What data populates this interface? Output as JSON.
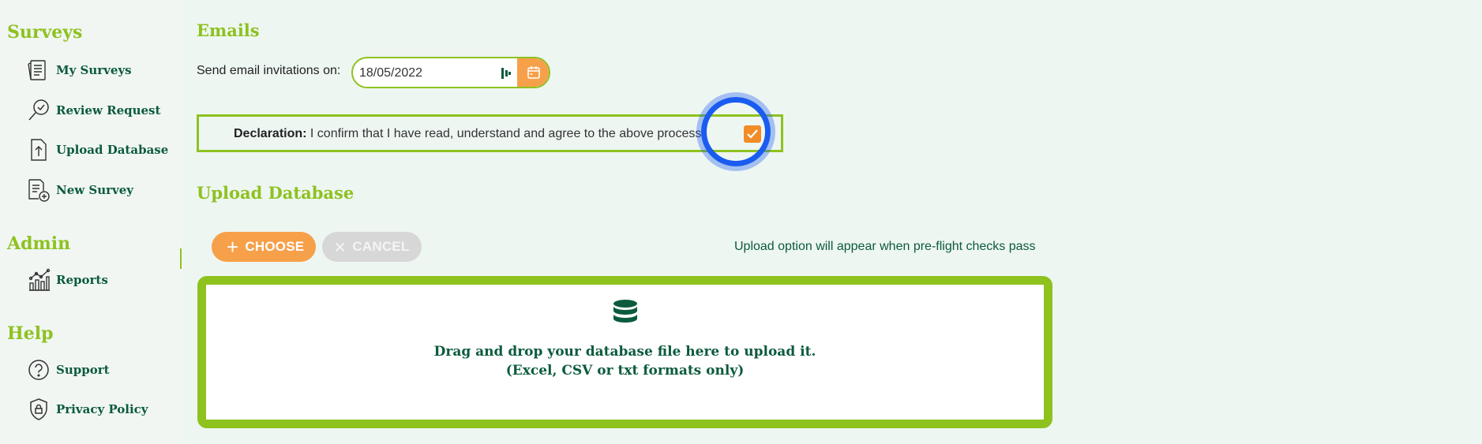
{
  "sidebar": {
    "sections": [
      {
        "title": "Surveys"
      },
      {
        "title": "Admin"
      },
      {
        "title": "Help"
      }
    ],
    "items": [
      {
        "label": "My Surveys",
        "icon": "my-surveys-icon"
      },
      {
        "label": "Review Request",
        "icon": "review-request-icon"
      },
      {
        "label": "Upload Database",
        "icon": "upload-database-icon"
      },
      {
        "label": "New Survey",
        "icon": "new-survey-icon"
      },
      {
        "label": "Reports",
        "icon": "reports-icon"
      },
      {
        "label": "Support",
        "icon": "support-icon"
      },
      {
        "label": "Privacy Policy",
        "icon": "privacy-policy-icon"
      }
    ]
  },
  "emails": {
    "title": "Emails",
    "send_label": "Send email invitations on:",
    "date_value": "18/05/2022"
  },
  "declaration": {
    "bold": "Declaration:",
    "text": " I confirm that I have read, understand and agree to the above process:",
    "checked": true
  },
  "upload": {
    "title": "Upload Database",
    "choose_label": "CHOOSE",
    "cancel_label": "CANCEL",
    "note": "Upload option will appear when pre-flight checks pass",
    "drop_line1": "Drag and drop your database file here to upload it.",
    "drop_line2": "(Excel, CSV or txt formats only)"
  },
  "colors": {
    "accent_green": "#8ec21f",
    "dark_green": "#0b5b3c",
    "orange": "#f7a04a",
    "focus_blue": "#1a5cf0"
  }
}
